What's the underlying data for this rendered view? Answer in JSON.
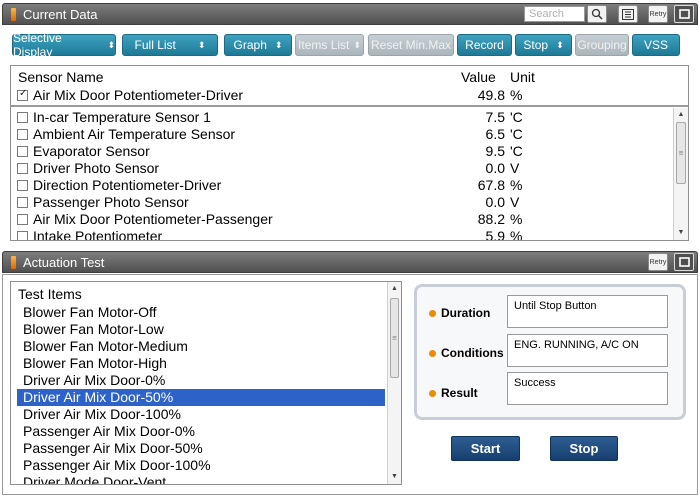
{
  "current_data": {
    "title": "Current Data",
    "search_placeholder": "Search",
    "retry_label": "Retry",
    "toolbar": {
      "selective_display": "Selective Display",
      "full_list": "Full List",
      "graph": "Graph",
      "items_list": "Items List",
      "reset_min_max": "Reset Min.Max",
      "record": "Record",
      "stop": "Stop",
      "grouping": "Grouping",
      "vss": "VSS"
    },
    "columns": {
      "sensor_name": "Sensor Name",
      "value": "Value",
      "unit": "Unit"
    },
    "pinned": {
      "name": "Air Mix Door Potentiometer-Driver",
      "value": "49.8",
      "unit": "%",
      "checked": true
    },
    "rows": [
      {
        "name": "In-car Temperature Sensor 1",
        "value": "7.5",
        "unit": "'C"
      },
      {
        "name": "Ambient Air Temperature Sensor",
        "value": "6.5",
        "unit": "'C"
      },
      {
        "name": "Evaporator Sensor",
        "value": "9.5",
        "unit": "'C"
      },
      {
        "name": "Driver Photo Sensor",
        "value": "0.0",
        "unit": "V"
      },
      {
        "name": "Direction Potentiometer-Driver",
        "value": "67.8",
        "unit": "%"
      },
      {
        "name": "Passenger Photo Sensor",
        "value": "0.0",
        "unit": "V"
      },
      {
        "name": "Air Mix Door Potentiometer-Passenger",
        "value": "88.2",
        "unit": "%"
      },
      {
        "name": "Intake Potentiometer",
        "value": "5.9",
        "unit": "%"
      }
    ]
  },
  "actuation_test": {
    "title": "Actuation Test",
    "retry_label": "Retry",
    "list_header": "Test Items",
    "items": [
      "Blower Fan Motor-Off",
      "Blower Fan Motor-Low",
      "Blower Fan Motor-Medium",
      "Blower Fan Motor-High",
      "Driver Air Mix Door-0%",
      "Driver Air Mix Door-50%",
      "Driver Air Mix Door-100%",
      "Passenger Air Mix Door-0%",
      "Passenger Air Mix Door-50%",
      "Passenger Air Mix Door-100%",
      "Driver Mode Door-Vent"
    ],
    "selected_index": 5,
    "fields": {
      "duration_label": "Duration",
      "duration_value": "Until Stop Button",
      "conditions_label": "Conditions",
      "conditions_value": "ENG. RUNNING, A/C ON",
      "result_label": "Result",
      "result_value": "Success"
    },
    "start_label": "Start",
    "stop_label": "Stop"
  },
  "colors": {
    "accent": "#2d8fae",
    "selection": "#2d62c8",
    "button_dark": "#1e4a80"
  }
}
